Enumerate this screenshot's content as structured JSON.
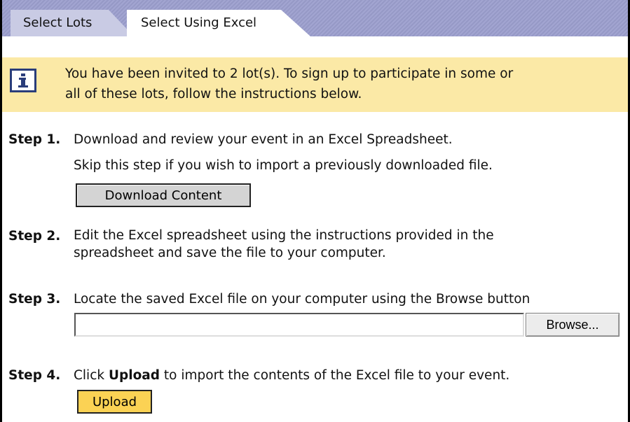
{
  "tabs": [
    {
      "label": "Select Lots",
      "active": false
    },
    {
      "label": "Select Using Excel",
      "active": true
    }
  ],
  "banner": {
    "icon": "info-icon",
    "line1": "You have been invited to 2 lot(s). To sign up to participate in some or",
    "line2": "all of these lots, follow the instructions below."
  },
  "steps": [
    {
      "label": "Step 1.",
      "line1": "Download and review your event in an Excel Spreadsheet.",
      "line2": "Skip this step if you wish to import a previously downloaded file.",
      "button": "Download Content"
    },
    {
      "label": "Step 2.",
      "line1": "Edit the Excel spreadsheet using the instructions provided in the",
      "line2": "spreadsheet and save the file to your computer."
    },
    {
      "label": "Step 3.",
      "line1": "Locate the saved Excel file on your computer using the Browse button",
      "file_value": "",
      "button": "Browse..."
    },
    {
      "label": "Step 4.",
      "pre": "Click ",
      "bold": "Upload",
      "post": " to import the contents of the Excel file to your event.",
      "button": "Upload"
    }
  ],
  "colors": {
    "tabbar": "#9c9fce",
    "banner": "#fbe9a6",
    "upload_button": "#fbd254"
  }
}
